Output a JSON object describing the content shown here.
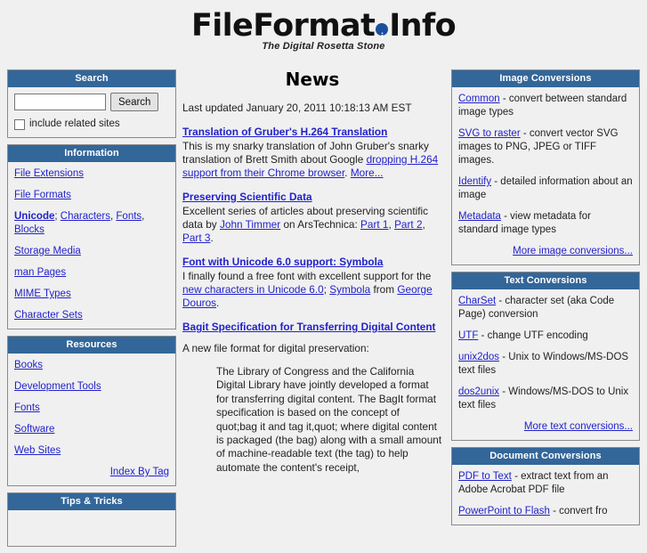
{
  "site": {
    "logo_part1": "FileFormat",
    "logo_dot_icon": "info-dot-icon",
    "logo_part2": "Info",
    "tagline": "The Digital Rosetta Stone"
  },
  "colors": {
    "header_blue": "#336699",
    "link_blue": "#2222cc",
    "page_bg": "#f0f0f0",
    "box_border": "#8a8a8a"
  },
  "sidebar_left": {
    "search": {
      "title": "Search",
      "input_value": "",
      "input_placeholder": "",
      "button_label": "Search",
      "checkbox_label": "include related sites",
      "checkbox_checked": false
    },
    "information": {
      "title": "Information",
      "items": [
        {
          "text": "File Extensions"
        },
        {
          "text": "File Formats"
        },
        {
          "text": "Unicode: Characters, Fonts, Blocks"
        },
        {
          "text": "Storage Media"
        },
        {
          "text": "man Pages"
        },
        {
          "text": "MIME Types"
        },
        {
          "text": "Character Sets"
        }
      ],
      "unicode_parts": {
        "lead": "Unicode",
        "sep1": "; ",
        "a": "Characters",
        "sep2": ", ",
        "b": "Fonts",
        "sep3": ", ",
        "c": "Blocks"
      }
    },
    "resources": {
      "title": "Resources",
      "items": [
        {
          "text": "Books"
        },
        {
          "text": "Development Tools"
        },
        {
          "text": "Fonts"
        },
        {
          "text": "Software"
        },
        {
          "text": "Web Sites"
        }
      ],
      "index_link": "Index By Tag"
    },
    "tips": {
      "title": "Tips & Tricks"
    }
  },
  "main": {
    "title": "News",
    "last_updated": "Last updated January 20, 2011 10:18:13 AM EST",
    "items": [
      {
        "headline": "Translation of Gruber's H.264 Translation",
        "body_pre": "This is my snarky translation of John Gruber's snarky translation of Brett Smith about Google ",
        "body_link": "dropping H.264 support from their Chrome browser",
        "body_mid": ". ",
        "body_more": "More...",
        "body_post": ""
      },
      {
        "headline": "Preserving Scientific Data",
        "body_pre": "Excellent series of articles about preserving scientific data by ",
        "author_link": "John Timmer",
        "body_mid": " on ArsTechnica: ",
        "part1": "Part 1",
        "sep1": ", ",
        "part2": "Part 2",
        "sep2": ", ",
        "part3": "Part 3",
        "body_post": "."
      },
      {
        "headline": "Font with Unicode 6.0 support: Symbola",
        "body_pre": "I finally found a free font with excellent support for the ",
        "link1": "new characters in Unicode 6.0",
        "body_mid": "; ",
        "link2": "Symbola",
        "body_mid2": " from ",
        "link3": "George Douros",
        "body_post": "."
      },
      {
        "headline": "Bagit Specification for Transferring Digital Content",
        "body_pre": "A new file format for digital preservation:",
        "quote": "The Library of Congress and the California Digital Library have jointly developed a format for transferring digital content. The BagIt format specification is based on the concept of quot;bag it and tag it,quot; where digital content is packaged (the bag) along with a small amount of machine-readable text (the tag) to help automate the content's receipt,"
      }
    ]
  },
  "sidebar_right": {
    "image_conversions": {
      "title": "Image Conversions",
      "items": [
        {
          "link": "Common",
          "desc": " - convert between standard image types"
        },
        {
          "link": "SVG to raster",
          "desc": " - convert vector SVG images to PNG, JPEG or TIFF images."
        },
        {
          "link": "Identify",
          "desc": " - detailed information about an image"
        },
        {
          "link": "Metadata",
          "desc": " - view metadata for standard image types"
        }
      ],
      "more_link": "More image conversions..."
    },
    "text_conversions": {
      "title": "Text Conversions",
      "items": [
        {
          "link": "CharSet",
          "desc": " - character set (aka Code Page) conversion"
        },
        {
          "link": "UTF",
          "desc": " - change UTF encoding"
        },
        {
          "link": "unix2dos",
          "desc": " - Unix to Windows/MS-DOS text files"
        },
        {
          "link": "dos2unix",
          "desc": " - Windows/MS-DOS to Unix text files"
        }
      ],
      "more_link": "More text conversions..."
    },
    "document_conversions": {
      "title": "Document Conversions",
      "items": [
        {
          "link": "PDF to Text",
          "desc": " - extract text from an Adobe Acrobat PDF file"
        },
        {
          "link": "PowerPoint to Flash",
          "desc": " - convert fro"
        }
      ]
    }
  }
}
